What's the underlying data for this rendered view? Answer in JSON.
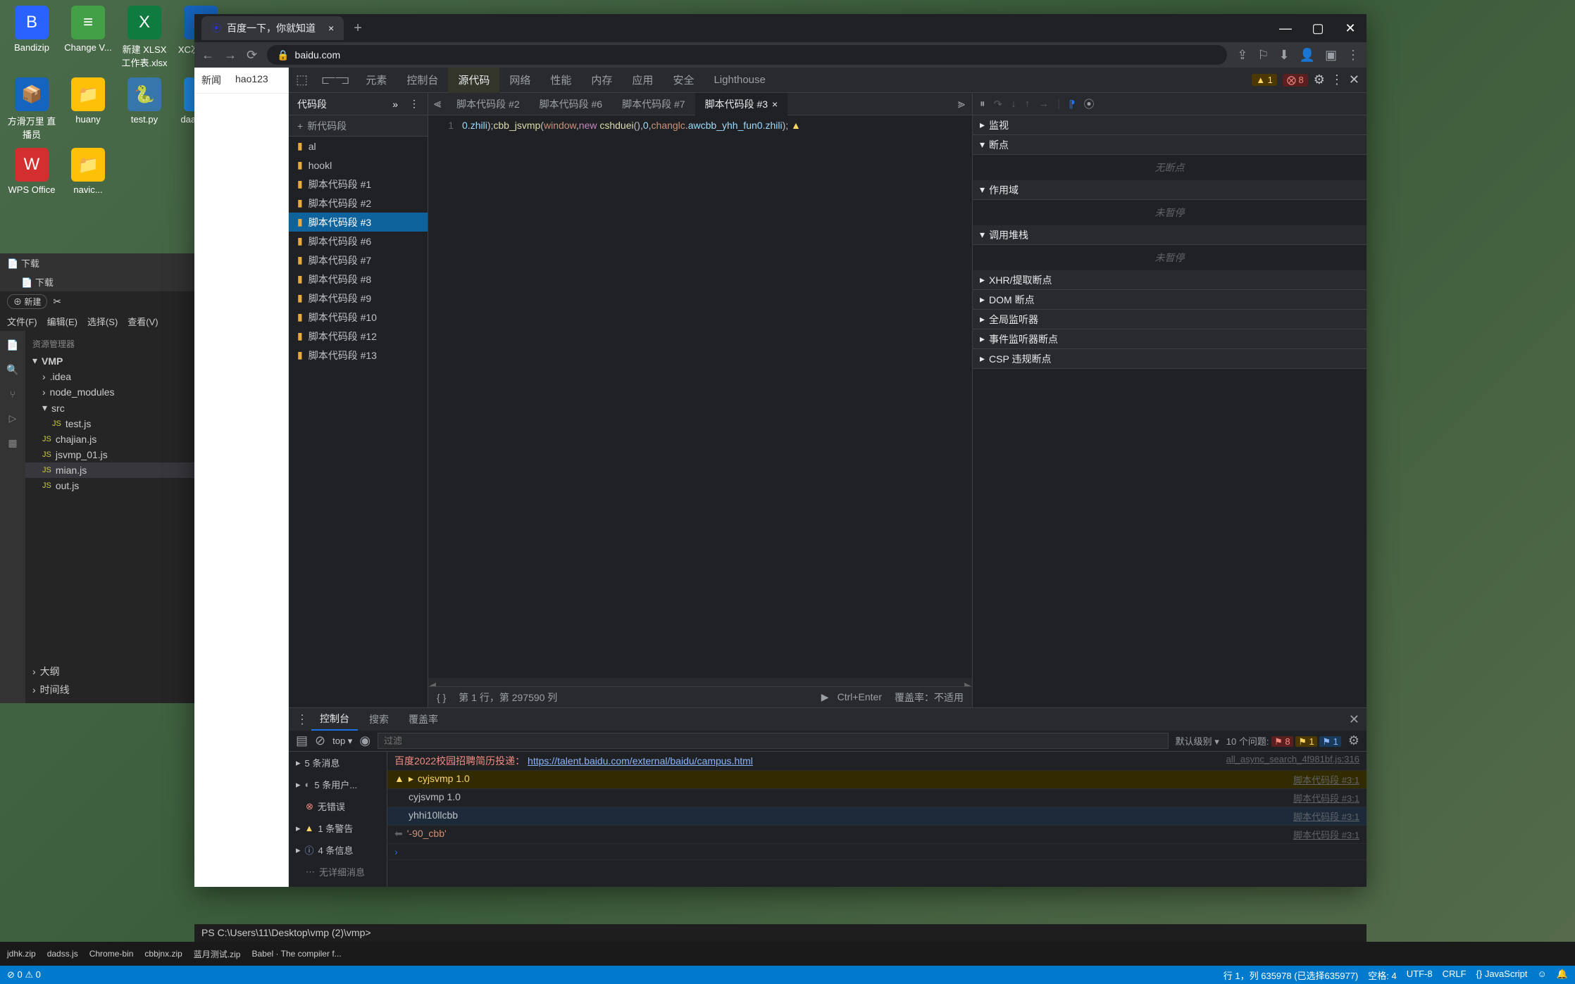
{
  "desktop_icons": [
    "Bandizip",
    "Change V...",
    "新建 XLSX 工作表.xlsx",
    "XC次人.zip",
    "方滑万里 直播员",
    "huany",
    "test.py",
    "daaa.html",
    "WPS Office",
    "navic..."
  ],
  "vscode": {
    "titles": [
      "下载",
      "下载"
    ],
    "menu": [
      "文件(F)",
      "编辑(E)",
      "选择(S)",
      "查看(V)"
    ],
    "new_btn": "新建",
    "explorer": "资源管理器",
    "tree": {
      "root": "VMP",
      "items": [
        {
          "name": ".idea",
          "type": "folder"
        },
        {
          "name": "node_modules",
          "type": "folder"
        },
        {
          "name": "src",
          "type": "folder"
        },
        {
          "name": "test.js",
          "type": "js"
        },
        {
          "name": "chajian.js",
          "type": "js"
        },
        {
          "name": "jsvmp_01.js",
          "type": "js"
        },
        {
          "name": "mian.js",
          "type": "js",
          "selected": true
        },
        {
          "name": "out.js",
          "type": "js"
        }
      ],
      "outline": "大纲",
      "timeline": "时间线"
    }
  },
  "browser": {
    "tab_title": "百度一下，你就知道",
    "url": "baidu.com",
    "page_nav": [
      "新闻",
      "hao123"
    ]
  },
  "devtools": {
    "tabs": [
      "元素",
      "控制台",
      "源代码",
      "网络",
      "性能",
      "内存",
      "应用",
      "安全",
      "Lighthouse"
    ],
    "active_tab": "源代码",
    "warn_count": "1",
    "err_count": "8",
    "left_panel": {
      "header": "代码段",
      "new": "新代码段",
      "items": [
        "al",
        "hookl",
        "脚本代码段 #1",
        "脚本代码段 #2",
        "脚本代码段 #3",
        "脚本代码段 #6",
        "脚本代码段 #7",
        "脚本代码段 #8",
        "脚本代码段 #9",
        "脚本代码段 #10",
        "脚本代码段 #12",
        "脚本代码段 #13"
      ],
      "selected": "脚本代码段 #3"
    },
    "editor_tabs": [
      "脚本代码段 #2",
      "脚本代码段 #6",
      "脚本代码段 #7",
      "脚本代码段 #3"
    ],
    "editor_active": "脚本代码段 #3",
    "code": "0.zhili);cbb_jsvmp(window,new cshduei(),0,changlc.awcbb_yhh_fun0.zhili);",
    "line_no": "1",
    "status": {
      "pos": "第 1 行，第 297590 列",
      "run": "Ctrl+Enter",
      "coverage": "覆盖率：不适用"
    },
    "debug": {
      "watch": "监视",
      "breakpoints": "断点",
      "bp_empty": "无断点",
      "scope": "作用域",
      "scope_empty": "未暂停",
      "callstack": "调用堆栈",
      "cs_empty": "未暂停",
      "xhr": "XHR/提取断点",
      "dom": "DOM 断点",
      "global": "全局监听器",
      "event": "事件监听器断点",
      "csp": "CSP 违规断点"
    }
  },
  "console": {
    "tabs": [
      "控制台",
      "搜索",
      "覆盖率"
    ],
    "filter_placeholder": "过滤",
    "context": "top",
    "level": "默认级别",
    "issues": "10 个问题:",
    "issue_err": "8",
    "issue_warn": "1",
    "issue_info": "1",
    "left": [
      {
        "label": "5 条消息"
      },
      {
        "label": "5 条用户...",
        "icon": "user"
      },
      {
        "label": "无错误",
        "icon": "error"
      },
      {
        "label": "1 条警告",
        "icon": "warn"
      },
      {
        "label": "4 条信息",
        "icon": "info"
      },
      {
        "label": "无详细消息"
      }
    ],
    "messages": [
      {
        "type": "recruit",
        "text": "百度2022校园招聘简历投递：",
        "link": "https://talent.baidu.com/external/baidu/campus.html",
        "src": "all_async_search_4f981bf.js:316"
      },
      {
        "type": "warning",
        "text": "cyjsvmp 1.0",
        "src": "脚本代码段 #3:1",
        "expand": true
      },
      {
        "type": "log",
        "text": "cyjsvmp 1.0",
        "src": "脚本代码段 #3:1"
      },
      {
        "type": "log",
        "text": "yhhi10llcbb",
        "src": "脚本代码段 #3:1"
      },
      {
        "type": "result",
        "text": "'-90_cbb'",
        "src": "脚本代码段 #3:1"
      }
    ]
  },
  "statusbar": {
    "left": "⊘ 0 ⚠ 0",
    "right": [
      "行 1，列 635978 (已选择635977)",
      "空格: 4",
      "UTF-8",
      "CRLF",
      "{} JavaScript"
    ]
  },
  "taskbar_items": [
    "jdhk.zip",
    "dadss.js",
    "Chrome-bin",
    "cbbjnx.zip",
    "蓝月测试.zip",
    "Babel · The compiler f..."
  ],
  "terminal_prompt": "PS C:\\Users\\11\\Desktop\\vmp (2)\\vmp>"
}
